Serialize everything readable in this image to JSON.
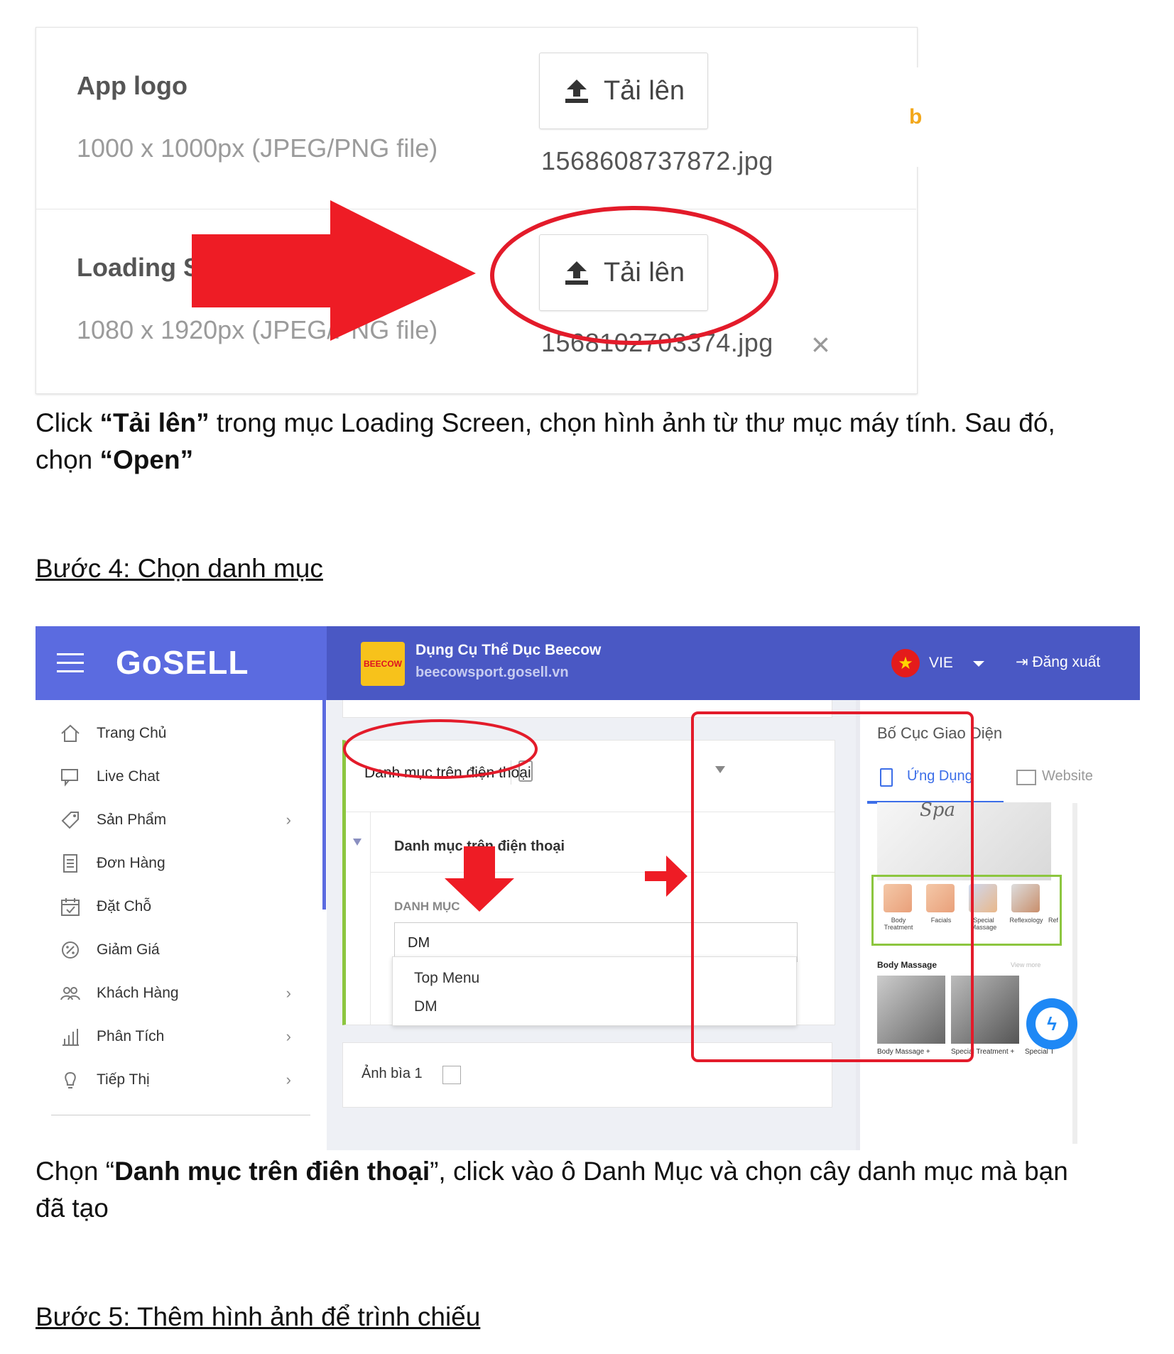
{
  "upload": {
    "app_logo_label": "App logo",
    "app_logo_size": "1000 x 1000px (JPEG/PNG file)",
    "app_logo_file": "1568608737872.jpg",
    "loading_label": "Loading S",
    "loading_size": "1080 x 1920px (JPEG/PNG file)",
    "loading_file": "1568102703374.jpg",
    "button_label": "Tải lên",
    "side_letter": "b",
    "remove_symbol": "×"
  },
  "caption1": {
    "part1": "Click ",
    "bold1": "“Tải lên”",
    "part2": " trong mục Loading Screen, chọn hình ảnh từ thư mục máy tính. Sau đó,",
    "part3": "chọn ",
    "bold2": "“Open”"
  },
  "step4": {
    "heading": "Bước 4: Chọn danh mục "
  },
  "app": {
    "brand": "GoSELL",
    "store_name": "Dụng Cụ Thể Dục Beecow",
    "store_url": "beecowsport.gosell.vn",
    "store_logo_text": "BEECOW",
    "lang": "VIE",
    "logout": "Đăng xuất",
    "sidebar": [
      {
        "label": "Trang Chủ",
        "icon": "home-icon",
        "chev": ""
      },
      {
        "label": "Live Chat",
        "icon": "chat-icon",
        "chev": ""
      },
      {
        "label": "Sản Phẩm",
        "icon": "tag-icon",
        "chev": "›"
      },
      {
        "label": "Đơn Hàng",
        "icon": "receipt-icon",
        "chev": ""
      },
      {
        "label": "Đặt Chỗ",
        "icon": "calendar-icon",
        "chev": ""
      },
      {
        "label": "Giảm Giá",
        "icon": "discount-icon",
        "chev": ""
      },
      {
        "label": "Khách Hàng",
        "icon": "users-icon",
        "chev": "›"
      },
      {
        "label": "Phân Tích",
        "icon": "chart-icon",
        "chev": "›"
      },
      {
        "label": "Tiếp Thị",
        "icon": "bulb-icon",
        "chev": "›"
      }
    ],
    "section_title": "Danh mục trên điện thoại",
    "section_sub": "Danh mục trên điện thoại",
    "field_label": "DANH MỤC",
    "field_value": "DM",
    "options": [
      "Top Menu",
      "DM"
    ],
    "cover_label": "Ảnh bìa 1",
    "preview_title": "Bố Cục Giao Diện",
    "tab_app": "Ứng Dụng",
    "tab_web": "Website",
    "preview_spa": "Spa",
    "categories": [
      "Body\nTreatment",
      "Facials",
      "Special\nMassage",
      "Reflexology",
      "Ref"
    ],
    "body_massage": "Body Massage",
    "view_more": "View more",
    "product_names": [
      "Body Massage +",
      "Special Treatment +",
      "Special T"
    ]
  },
  "caption2": {
    "part1": "Chọn “",
    "bold": "Danh mục trên điên thoại",
    "part2": "”, click vào ô Danh Mục và chọn cây danh mục mà bạn",
    "part3": "đã tạo"
  },
  "step5": {
    "heading": "Bước 5: Thêm hình ảnh để trình chiếu "
  }
}
